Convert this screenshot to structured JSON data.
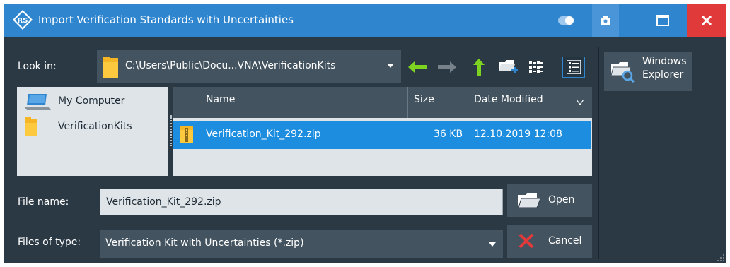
{
  "window": {
    "title": "Import Verification Standards with Uncertainties",
    "accent_color": "#2f86cf",
    "close_color": "#e03a3a",
    "selection_color": "#1d8de0",
    "body_color": "#2b3945"
  },
  "titlebar_icons": [
    "rs-logo-icon",
    "toggle-icon",
    "camera-icon",
    "maximize-icon",
    "close-icon"
  ],
  "look_in": {
    "label": "Look in:",
    "path": "C:\\Users\\Public\\Docu...VNA\\VerificationKits"
  },
  "toolbar_icons": [
    "back-arrow-icon",
    "forward-arrow-icon",
    "up-arrow-icon",
    "new-folder-icon",
    "list-view-icon",
    "details-view-icon"
  ],
  "places": [
    {
      "label": "My Computer",
      "icon": "computer-icon"
    },
    {
      "label": "VerificationKits",
      "icon": "folder-icon"
    }
  ],
  "file_list": {
    "columns": [
      "Name",
      "Size",
      "Date Modified"
    ],
    "rows": [
      {
        "name": "Verification_Kit_292.zip",
        "size": "36 KB",
        "date": "12.10.2019 12:08",
        "selected": true
      }
    ]
  },
  "file_name": {
    "label_prefix": "File ",
    "label_underlined": "n",
    "label_suffix": "ame:",
    "value": "Verification_Kit_292.zip"
  },
  "file_type": {
    "label": "Files of type:",
    "value": "Verification Kit with Uncertainties (*.zip)"
  },
  "buttons": {
    "open": "Open",
    "cancel": "Cancel",
    "explorer_line1": "Windows",
    "explorer_line2": "Explorer"
  }
}
